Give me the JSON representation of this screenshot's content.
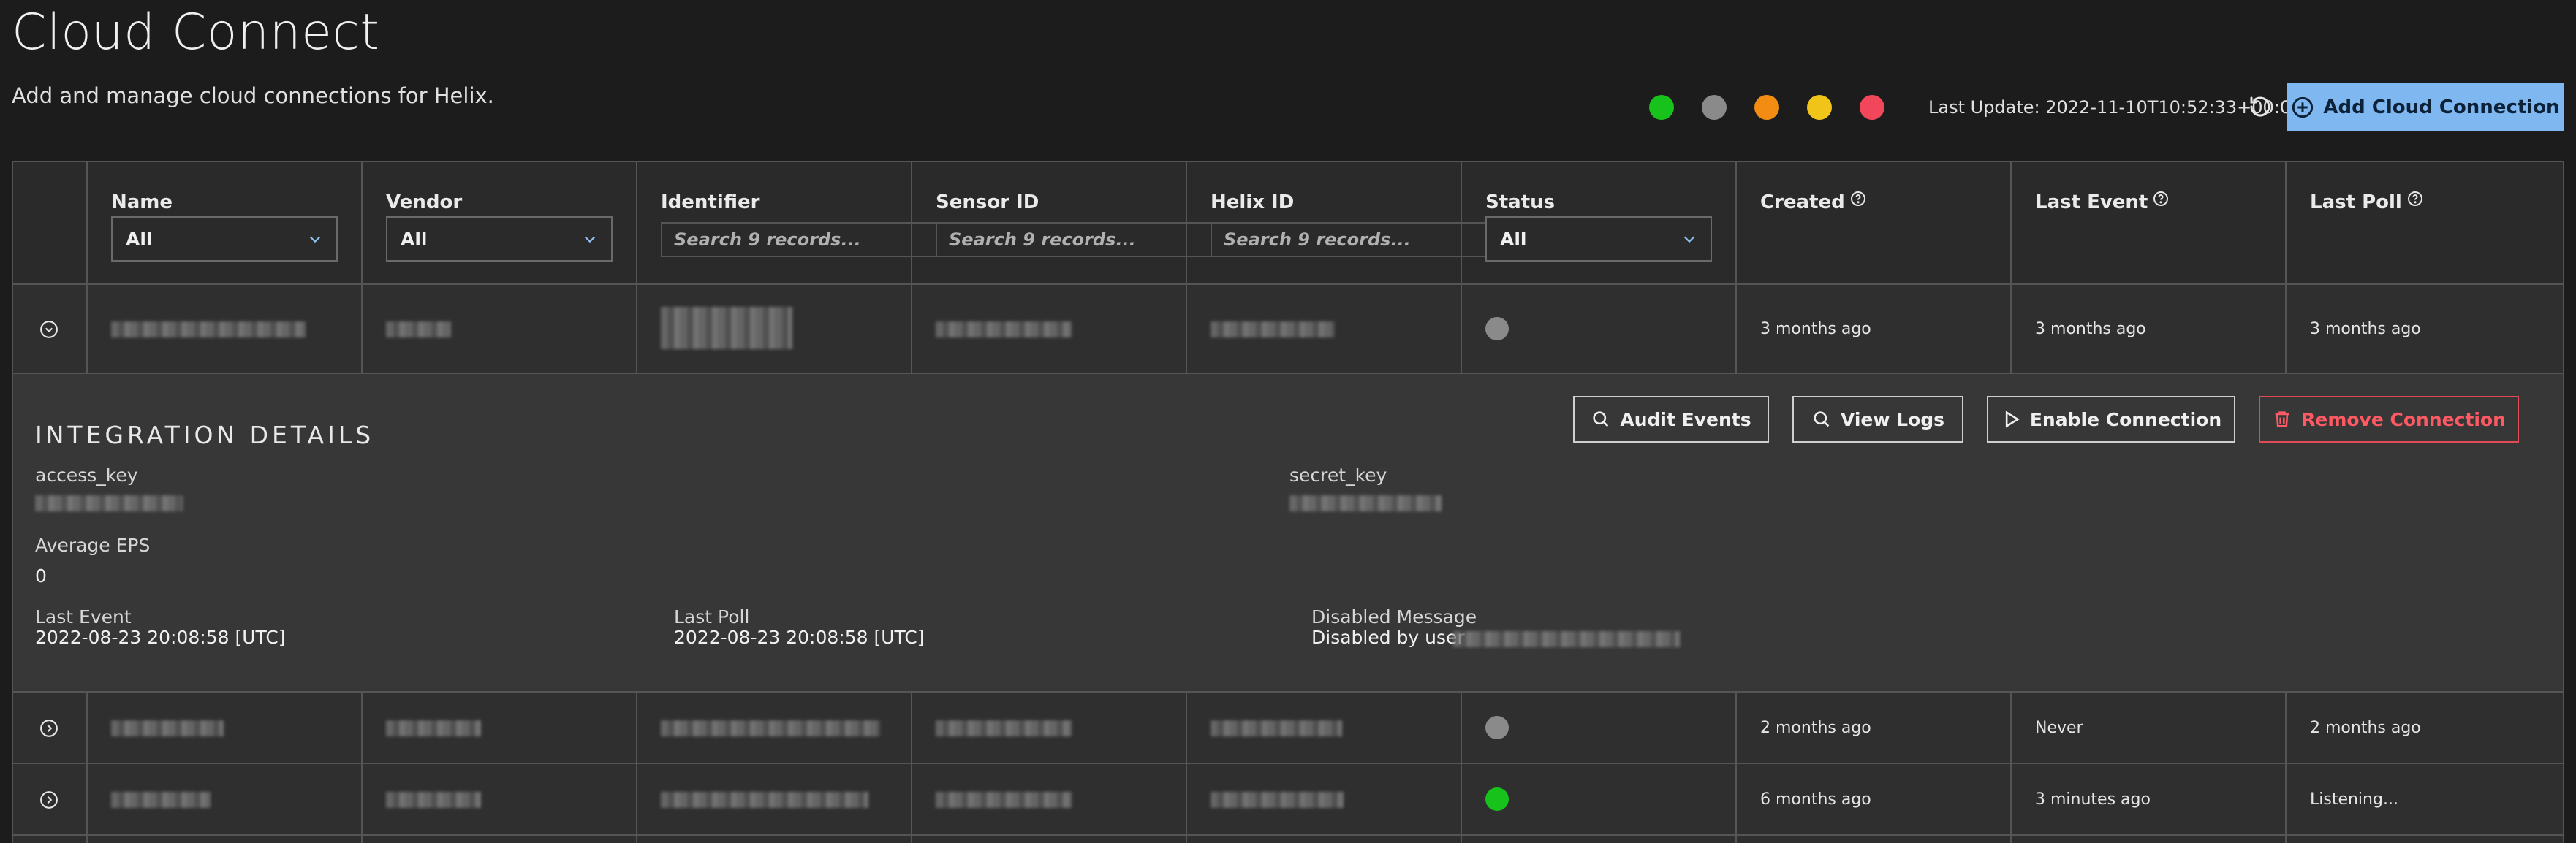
{
  "header": {
    "title": "Cloud Connect",
    "subtitle": "Add and manage cloud connections for Helix.",
    "last_update": "Last Update: 2022-11-10T10:52:33+00:00",
    "add_button": "Add Cloud Connection"
  },
  "legend_colors": [
    "#17c21a",
    "#8a8a8a",
    "#f28c12",
    "#f0c419",
    "#f2475a"
  ],
  "columns": {
    "name": "Name",
    "vendor": "Vendor",
    "identifier": "Identifier",
    "sensor_id": "Sensor ID",
    "helix_id": "Helix ID",
    "status": "Status",
    "created": "Created",
    "last_event": "Last Event",
    "last_poll": "Last Poll"
  },
  "filters": {
    "name": "All",
    "vendor": "All",
    "status": "All",
    "search_placeholder": "Search 9 records..."
  },
  "rows": [
    {
      "status_color": "#8a8a8a",
      "created": "3 months ago",
      "last_event": "3 months ago",
      "last_poll": "3 months ago"
    },
    {
      "status_color": "#8a8a8a",
      "created": "2 months ago",
      "last_event": "Never",
      "last_poll": "2 months ago"
    },
    {
      "status_color": "#17c21a",
      "created": "6 months ago",
      "last_event": "3 minutes ago",
      "last_poll": "Listening..."
    }
  ],
  "details": {
    "title": "INTEGRATION DETAILS",
    "buttons": {
      "audit": "Audit Events",
      "logs": "View Logs",
      "enable": "Enable Connection",
      "remove": "Remove Connection"
    },
    "access_key_label": "access_key",
    "secret_key_label": "secret_key",
    "avg_eps_label": "Average EPS",
    "avg_eps_value": "0",
    "last_event_label": "Last Event",
    "last_event_value": "2022-08-23 20:08:58 [UTC]",
    "last_poll_label": "Last Poll",
    "last_poll_value": "2022-08-23 20:08:58 [UTC]",
    "disabled_label": "Disabled Message",
    "disabled_value": "Disabled by user"
  }
}
